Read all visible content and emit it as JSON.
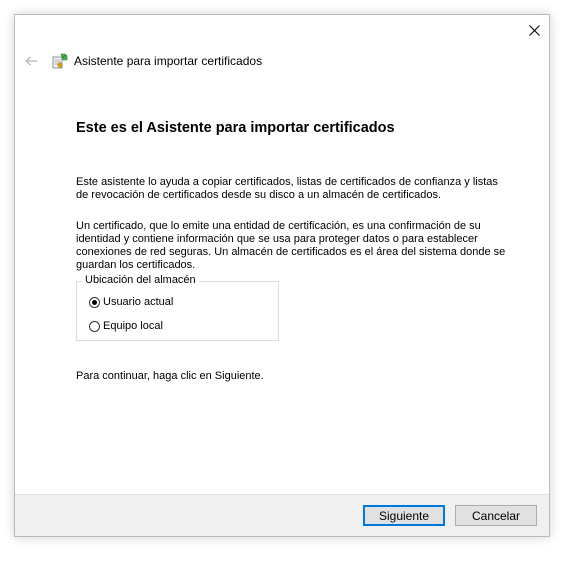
{
  "window": {
    "close_icon": "close-icon"
  },
  "header": {
    "back_icon": "back-arrow-icon",
    "wizard_icon": "certificate-wizard-icon",
    "title": "Asistente para importar certificados"
  },
  "main": {
    "heading": "Este es el Asistente para importar certificados",
    "intro": "Este asistente lo ayuda a copiar certificados, listas de certificados de confianza y listas de revocación de certificados desde su disco a un almacén de certificados.",
    "description": "Un certificado, que lo emite una entidad de certificación, es una confirmación de su identidad y contiene información que se usa para proteger datos o para establecer conexiones de red seguras. Un almacén de certificados es el área del sistema donde se guardan los certificados.",
    "store_location": {
      "legend": "Ubicación del almacén",
      "options": [
        {
          "label": "Usuario actual",
          "selected": true
        },
        {
          "label": "Equipo local",
          "selected": false
        }
      ]
    },
    "continue_text": "Para continuar, haga clic en Siguiente."
  },
  "footer": {
    "next_label": "Siguiente",
    "cancel_label": "Cancelar"
  },
  "colors": {
    "accent": "#0078d7",
    "footer_bg": "#f0f0f0",
    "button_bg": "#e1e1e1"
  }
}
